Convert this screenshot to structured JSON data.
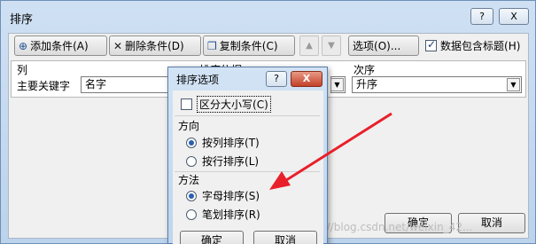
{
  "main_dialog": {
    "title": "排序",
    "help_label": "?",
    "close_label": "X",
    "toolbar": {
      "add_label": "添加条件",
      "add_key": "(A)",
      "delete_label": "删除条件",
      "delete_key": "(D)",
      "copy_label": "复制条件",
      "copy_key": "(C)",
      "options_label": "选项",
      "options_key": "(O)...",
      "header_checkbox_label": "数据包含标题",
      "header_checkbox_key": "(H)",
      "header_checked": true
    },
    "columns": {
      "col": "列",
      "sort_on": "排序依据",
      "order": "次序"
    },
    "row": {
      "label": "主要关键字",
      "key_value": "名字",
      "order_value": "升序"
    },
    "ok_label": "确定",
    "cancel_label": "取消"
  },
  "options_dialog": {
    "title": "排序选项",
    "help_label": "?",
    "close_label": "X",
    "case_label": "区分大小写",
    "case_key": "(C)",
    "case_checked": false,
    "direction_group": "方向",
    "direction_options": [
      {
        "label": "按列排序",
        "key": "(T)",
        "selected": true
      },
      {
        "label": "按行排序",
        "key": "(L)",
        "selected": false
      }
    ],
    "method_group": "方法",
    "method_options": [
      {
        "label": "字母排序",
        "key": "(S)",
        "selected": true
      },
      {
        "label": "笔划排序",
        "key": "(R)",
        "selected": false
      }
    ],
    "ok_label": "确定",
    "cancel_label": "取消"
  },
  "watermark": "http://blog.csdn.net/weixin_42...",
  "colors": {
    "annotation_arrow": "#e8202a",
    "selection_blue": "#2a5fb0"
  }
}
